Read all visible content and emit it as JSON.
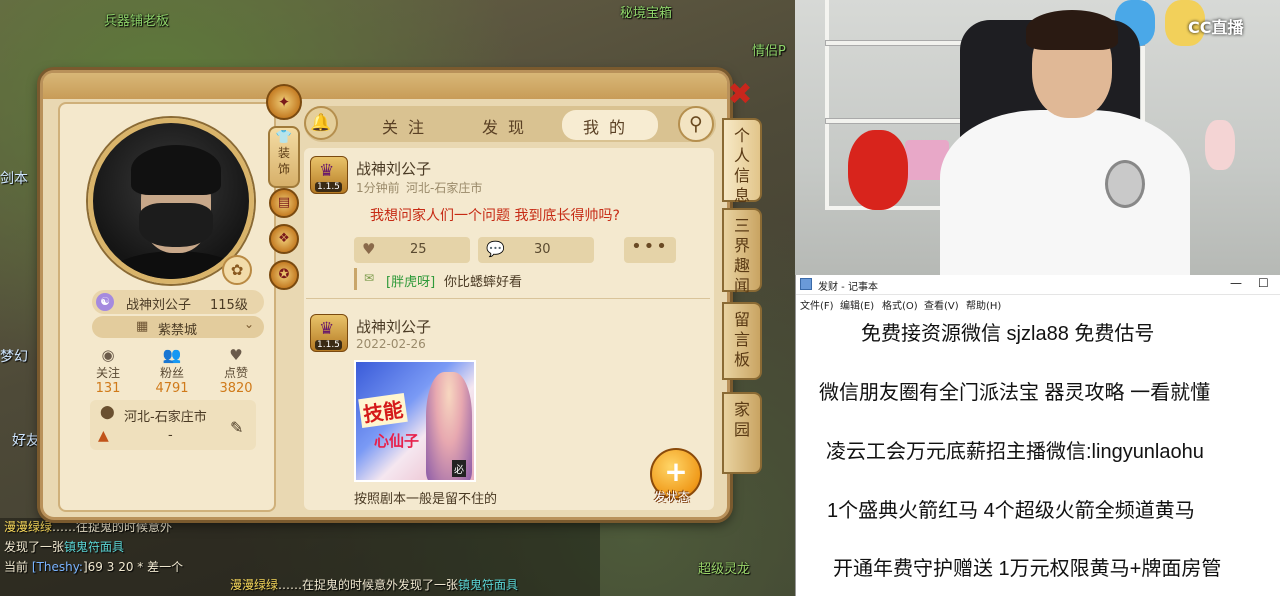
{
  "game": {
    "map_labels": [
      "兵器铺老板",
      "秘境宝箱",
      "情侣P"
    ],
    "left_tags": [
      "剑本",
      "梦幻",
      "好友"
    ],
    "chat": {
      "line1_user": "漫漫绿绿",
      "line1_text": "……往捉鬼的时候意外",
      "line2_text": "发现了一张",
      "line2_item": "镇鬼符面具",
      "line3_prefix": "当前",
      "line3_channel": "[Theshy:",
      "line3_text": "]69 3 20 * 差一个",
      "line4_user": "漫漫绿绿",
      "line4_text": "……在捉鬼的时候意外发现了一张",
      "line4_item": "镇鬼符面具"
    },
    "bottom_right_label": "超级灵龙"
  },
  "profile": {
    "name": "战神刘公子",
    "level": "115级",
    "server": "紫禁城",
    "stats": [
      {
        "label": "关注",
        "value": "131",
        "icon": "eye-icon"
      },
      {
        "label": "粉丝",
        "value": "4791",
        "icon": "users-icon"
      },
      {
        "label": "点赞",
        "value": "3820",
        "icon": "heart-icon"
      }
    ],
    "location": "河北-石家庄市",
    "title_value": "-",
    "decor_tab": "装饰"
  },
  "tabs": {
    "follow": "关注",
    "discover": "发现",
    "mine": "我的"
  },
  "side_tabs": [
    "个人信息",
    "三界趣闻",
    "留言板",
    "家园"
  ],
  "posts": [
    {
      "author": "战神刘公子",
      "badge_level": "1.1.5",
      "meta_time": "1分钟前",
      "meta_loc": "河北-石家庄市",
      "text": "我想问家人们一个问题  我到底长得帅吗?",
      "likes": "25",
      "comments": "30",
      "more": "•••",
      "comment_user": "[胖虎呀]",
      "comment_text": "你比蟋蟀好看"
    },
    {
      "author": "战神刘公子",
      "badge_level": "1.1.5",
      "meta_time": "2022-02-26",
      "image_text1": "技能",
      "image_text2": "心仙子",
      "image_tag": "必",
      "caption": "按照剧本一般是留不住的"
    }
  ],
  "post_button": {
    "plus": "+",
    "label": "发状态"
  },
  "close": "✖",
  "webcam": {
    "logo": "CC直播"
  },
  "notepad": {
    "title": "发财 - 记事本",
    "menu": [
      "文件(F)",
      "编辑(E)",
      "格式(O)",
      "查看(V)",
      "帮助(H)"
    ],
    "lines": [
      "免费接资源微信 sjzla88 免费估号",
      "微信朋友圈有全门派法宝 器灵攻略  一看就懂",
      "凌云工会万元底薪招主播微信:lingyunlaohu",
      "1个盛典火箭红马      4个超级火箭全频道黄马",
      "开通年费守护赠送 1万元权限黄马+牌面房管"
    ]
  }
}
